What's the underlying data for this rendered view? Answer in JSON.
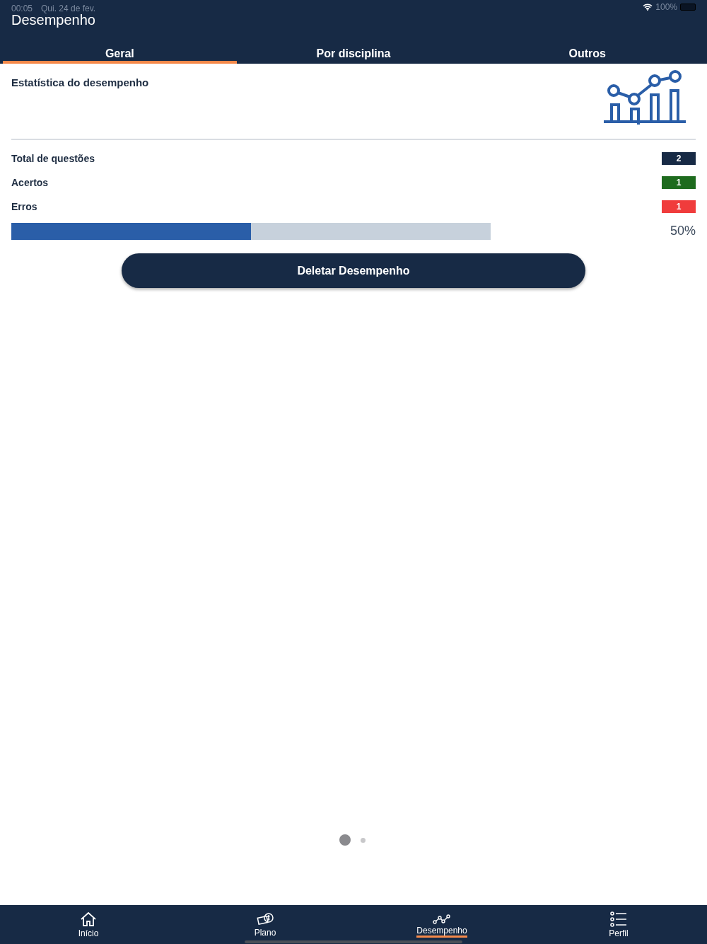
{
  "status_bar": {
    "time": "00:05",
    "date": "Qui. 24 de fev.",
    "battery": "100%"
  },
  "header": {
    "title": "Desempenho"
  },
  "tabs": [
    {
      "label": "Geral",
      "selected": true
    },
    {
      "label": "Por disciplina",
      "selected": false
    },
    {
      "label": "Outros",
      "selected": false
    }
  ],
  "card": {
    "title": "Estatística do desempenho"
  },
  "stats": [
    {
      "label": "Total de questões",
      "value": "2",
      "color": "#172a45"
    },
    {
      "label": "Acertos",
      "value": "1",
      "color": "#1e6b1e"
    },
    {
      "label": "Erros",
      "value": "1",
      "color": "#f03c3c"
    }
  ],
  "progress": {
    "level": 0.5,
    "reading": "50%"
  },
  "delete_button": "Deletar Desempenho",
  "pager": [
    {
      "selected": true
    },
    {
      "selected": false
    }
  ],
  "bottom_nav": [
    {
      "label": "Início",
      "selected": false
    },
    {
      "label": "Plano",
      "selected": false
    },
    {
      "label": "Desempenho",
      "selected": true
    },
    {
      "label": "Perfil",
      "selected": false
    }
  ]
}
